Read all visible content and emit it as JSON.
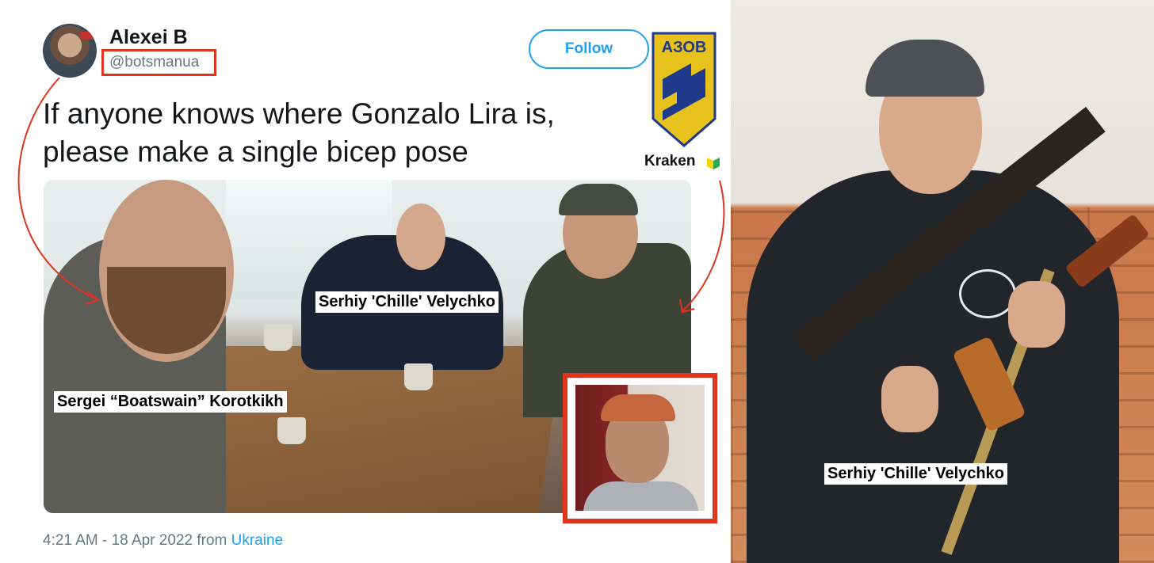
{
  "tweet": {
    "user_name": "Alexei B",
    "handle": "@botsmanua",
    "follow_label": "Follow",
    "text": "If anyone knows where Gonzalo Lira is, please make a single bicep pose",
    "timestamp": "4:21 AM - 18 Apr 2022 from",
    "location": "Ukraine"
  },
  "annotations": {
    "logo_text": "АЗОВ",
    "kraken_label": "Kraken",
    "label_center": "Serhiy 'Chille' Velychko",
    "label_left": "Sergei “Boatswain” Korotkikh",
    "label_right_photo": "Serhiy 'Chille' Velychko"
  },
  "colors": {
    "follow_blue": "#1da1f2",
    "highlight_red": "#e0341f",
    "logo_yellow": "#e8c21c",
    "logo_blue": "#1f3a8a"
  },
  "icons": {
    "kraken": "beginner-leaf-icon"
  }
}
